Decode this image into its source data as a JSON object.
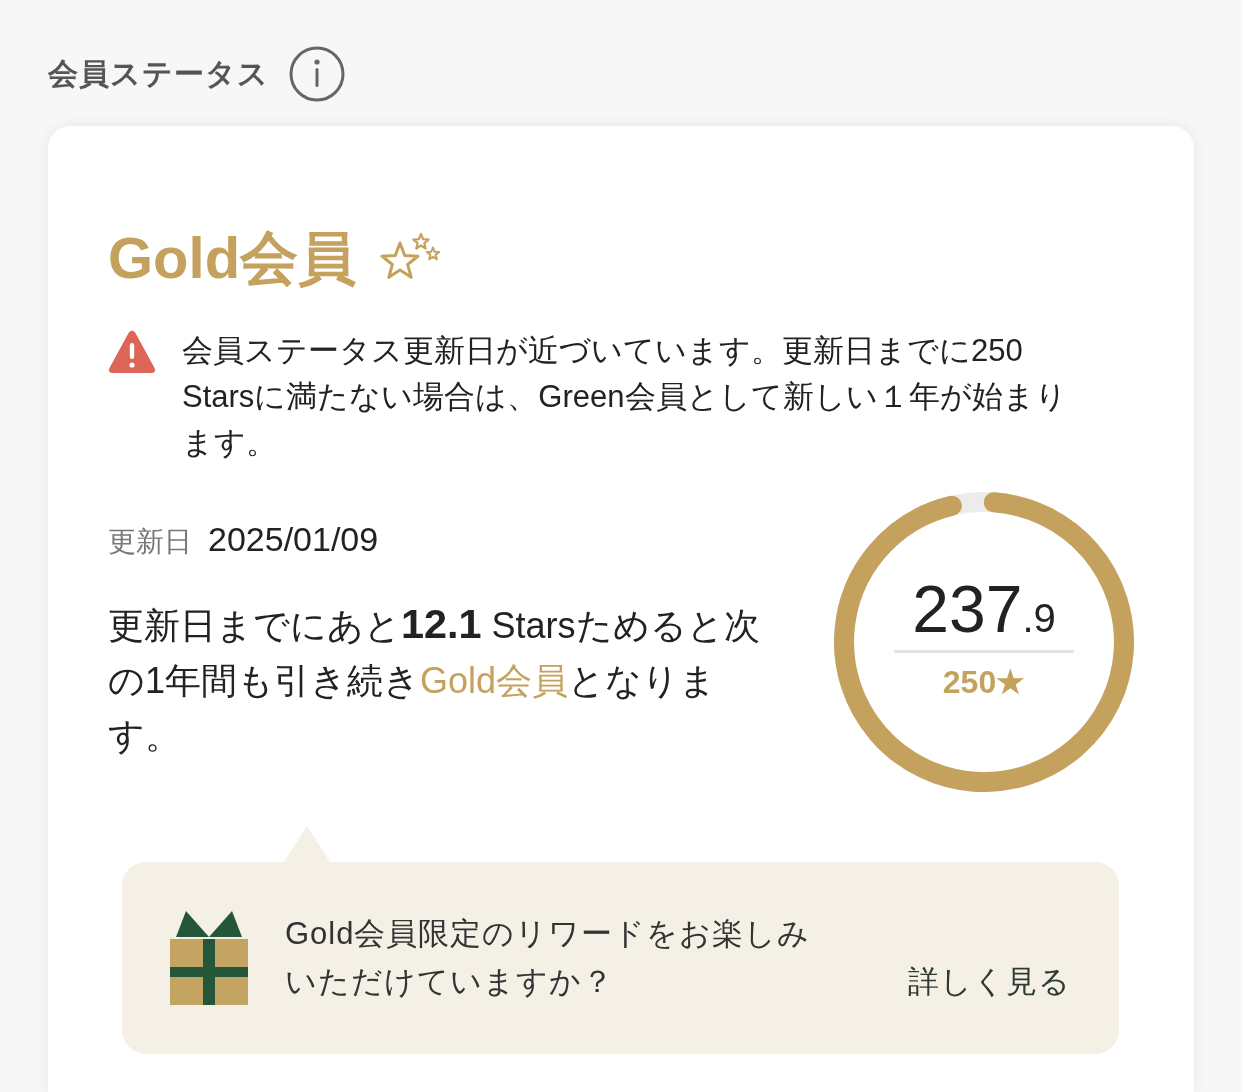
{
  "header": {
    "title": "会員ステータス"
  },
  "status_card": {
    "tier": "Gold会員",
    "notice": {
      "text": "会員ステータス更新日が近づいています。更新日までに250 Starsに満たない場合は、Green会員として新しい１年が始まります。"
    },
    "renewal": {
      "label": "更新日",
      "date": "2025/01/09"
    },
    "message_parts": [
      {
        "kind": "text",
        "text": "更新日までにあと**12.1** Starsためると次の1年間も引き続き"
      },
      {
        "kind": "highlight",
        "text": "Gold会員"
      },
      {
        "kind": "text",
        "text": "となります。"
      }
    ],
    "progress": {
      "value": "237",
      "decimal": ".9",
      "goal": "250★",
      "level": 0.9516
    },
    "reward_callout": {
      "text": "Gold会員限定のリワードをお楽しみいただけていますか？",
      "link": "詳しく見る"
    }
  }
}
